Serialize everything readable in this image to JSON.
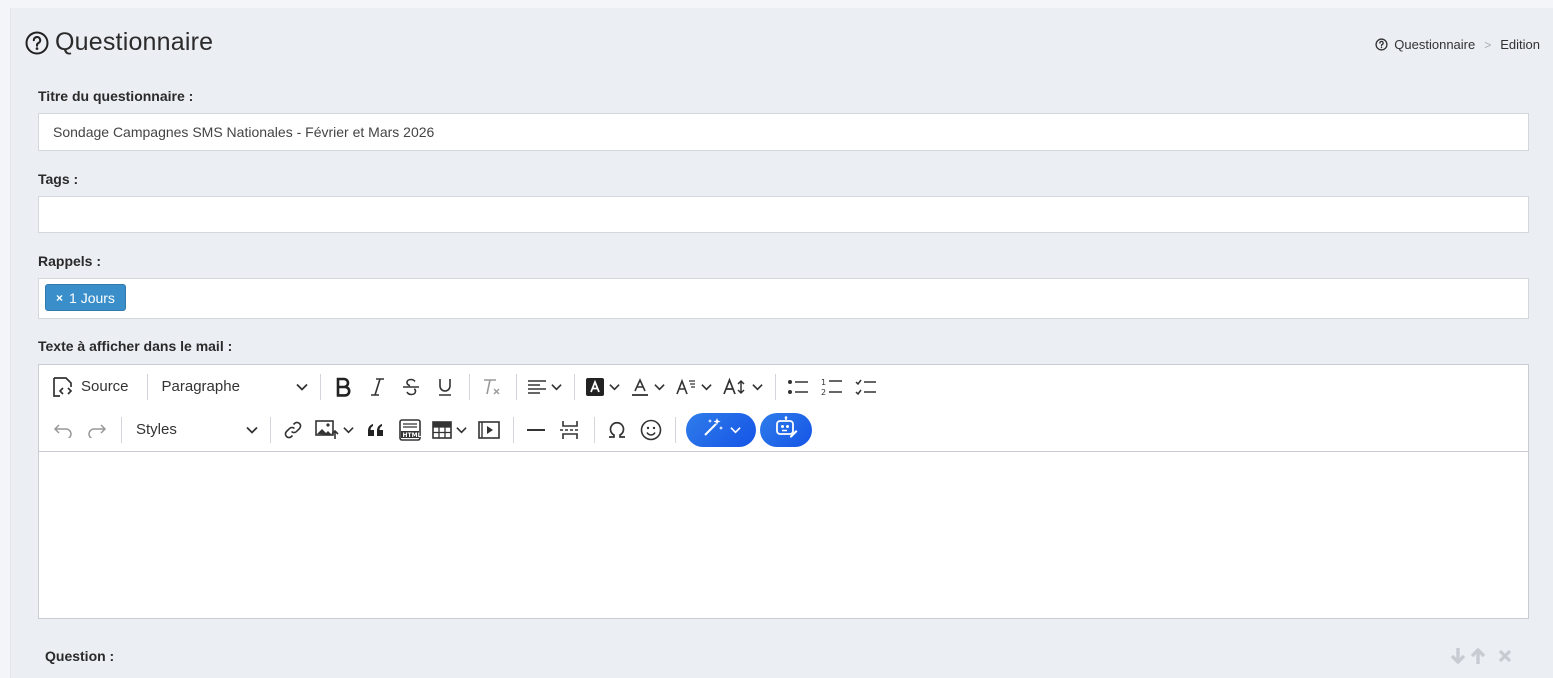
{
  "page": {
    "title": "Questionnaire",
    "breadcrumb": [
      "Questionnaire",
      "Edition"
    ],
    "breadcrumb_separator": ">"
  },
  "form": {
    "title_label": "Titre du questionnaire :",
    "title_value": "Sondage Campagnes SMS Nationales - Février et Mars 2026",
    "tags_label": "Tags :",
    "tags_value": "",
    "reminders_label": "Rappels :",
    "reminders_tags": [
      {
        "remove": "×",
        "label": "1 Jours"
      }
    ],
    "mail_text_label": "Texte à afficher dans le mail :"
  },
  "editor": {
    "source_label": "Source",
    "heading_select": "Paragraphe",
    "styles_select": "Styles",
    "content": ""
  },
  "question": {
    "label": "Question :"
  },
  "colors": {
    "accent": "#3a8fca",
    "ai_button": "#1554e6",
    "panel_bg": "#ebeef3"
  },
  "icons": {
    "toolbar_row1": [
      "source-icon",
      "bold-icon",
      "italic-icon",
      "strikethrough-icon",
      "underline-icon",
      "remove-format-icon",
      "align-icon",
      "highlight-icon",
      "font-color-icon",
      "font-family-icon",
      "font-size-icon",
      "bulleted-list-icon",
      "numbered-list-icon",
      "todo-list-icon"
    ],
    "toolbar_row2": [
      "undo-icon",
      "redo-icon",
      "link-icon",
      "insert-image-icon",
      "blockquote-icon",
      "html-embed-icon",
      "table-icon",
      "media-embed-icon",
      "horizontal-line-icon",
      "page-break-icon",
      "special-characters-icon",
      "emoji-icon",
      "ai-magic-icon",
      "ai-assistant-icon"
    ],
    "question_actions": [
      "move-down-icon",
      "move-up-icon",
      "delete-icon"
    ]
  }
}
